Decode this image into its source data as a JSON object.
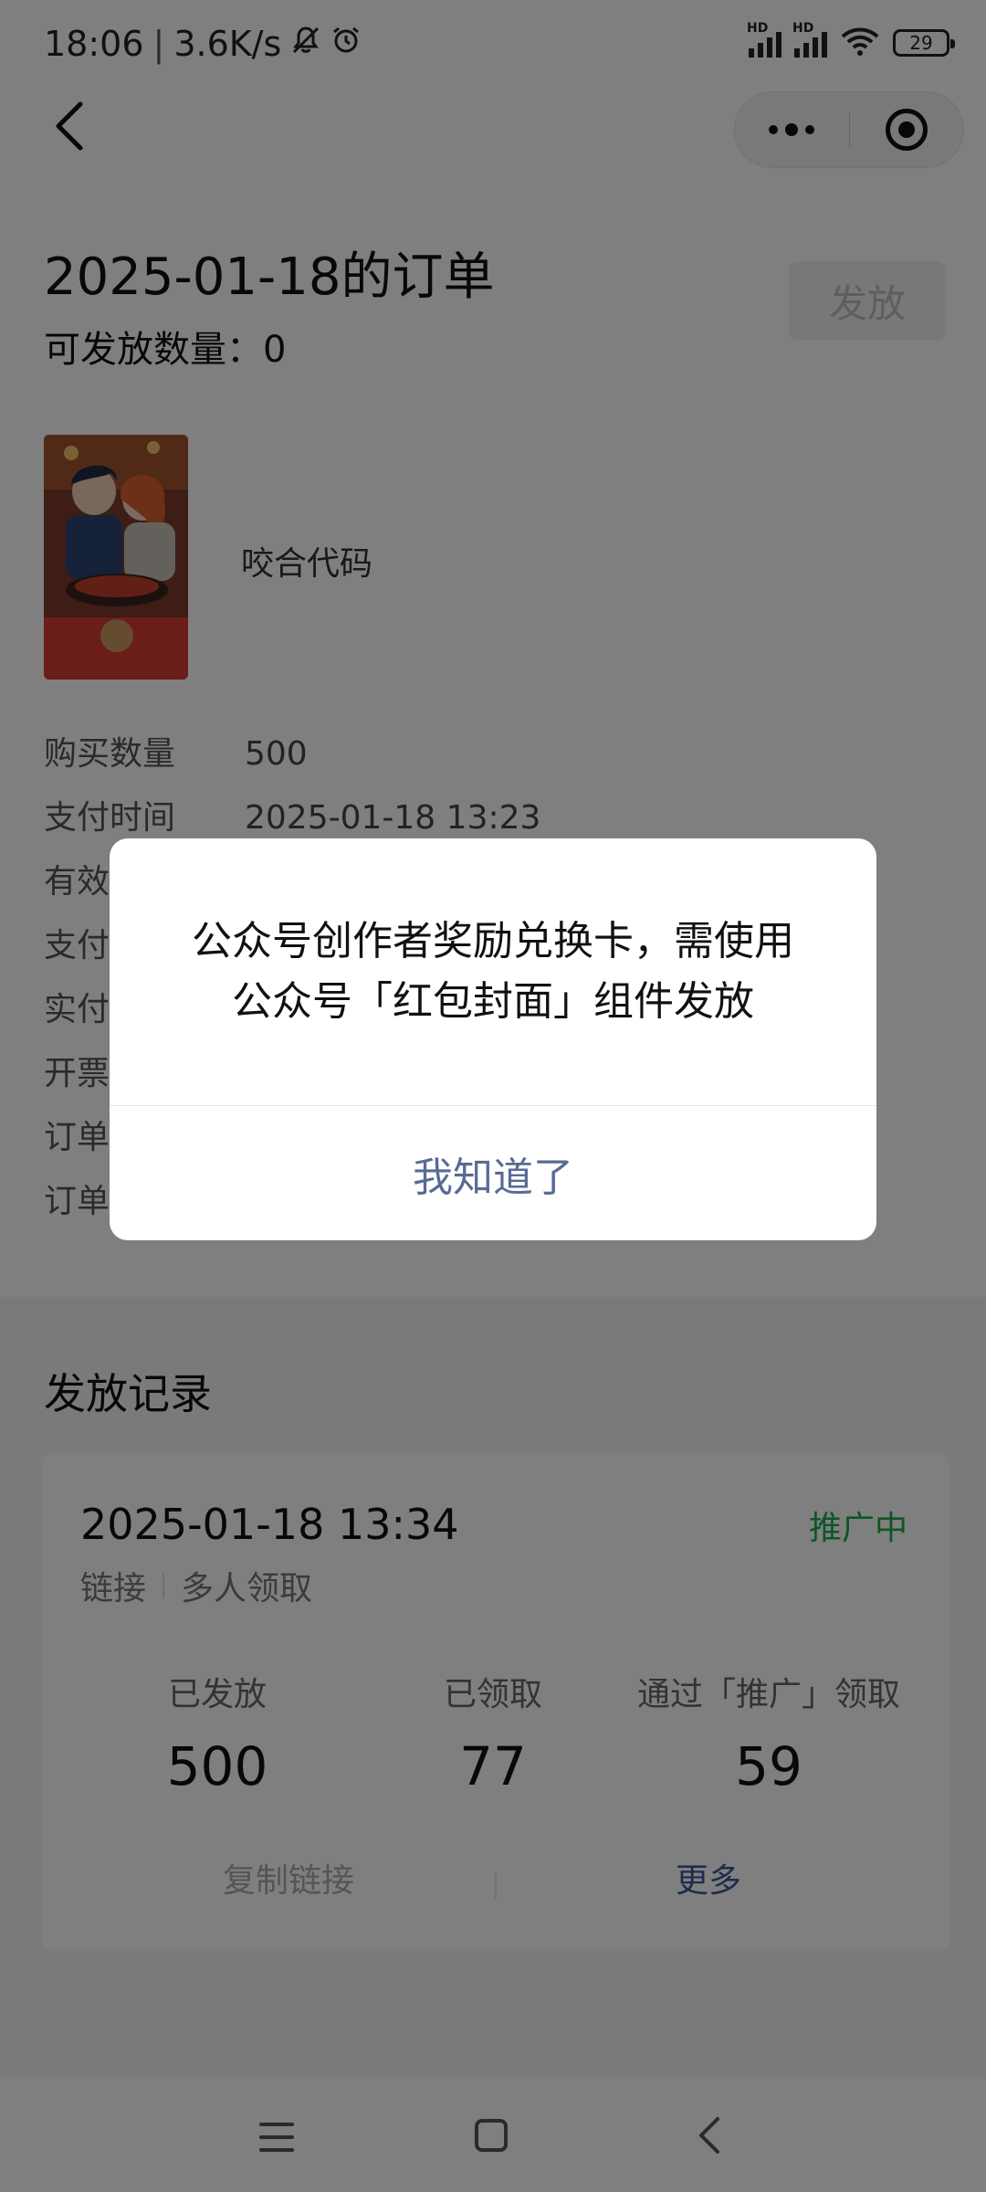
{
  "status_bar": {
    "time": "18:06",
    "speed": "3.6K/s",
    "battery": "29",
    "network_label": "HD"
  },
  "order": {
    "title": "2025-01-18的订单",
    "available_label": "可发放数量：",
    "available_value": "0",
    "issue_button": "发放"
  },
  "product": {
    "name": "咬合代码"
  },
  "details": [
    {
      "key": "购买数量",
      "value": "500"
    },
    {
      "key": "支付时间",
      "value": "2025-01-18 13:23"
    },
    {
      "key": "有效",
      "value": ""
    },
    {
      "key": "支付",
      "value": ""
    },
    {
      "key": "实付",
      "value": ""
    },
    {
      "key": "开票",
      "value": ""
    },
    {
      "key": "订单",
      "value": ""
    },
    {
      "key": "订单",
      "value": ""
    }
  ],
  "records": {
    "title": "发放记录",
    "item": {
      "time": "2025-01-18 13:34",
      "status": "推广中",
      "status_color": "#1aad4b",
      "type": "链接",
      "mode": "多人领取",
      "stats": [
        {
          "label": "已发放",
          "value": "500"
        },
        {
          "label": "已领取",
          "value": "77"
        },
        {
          "label": "通过「推广」领取",
          "value": "59"
        }
      ],
      "copy_link": "复制链接",
      "more": "更多"
    }
  },
  "dialog": {
    "line1": "公众号创作者奖励兑换卡，需使用",
    "line2": "公众号「红包封面」组件发放",
    "button": "我知道了",
    "button_color": "#576b95"
  }
}
